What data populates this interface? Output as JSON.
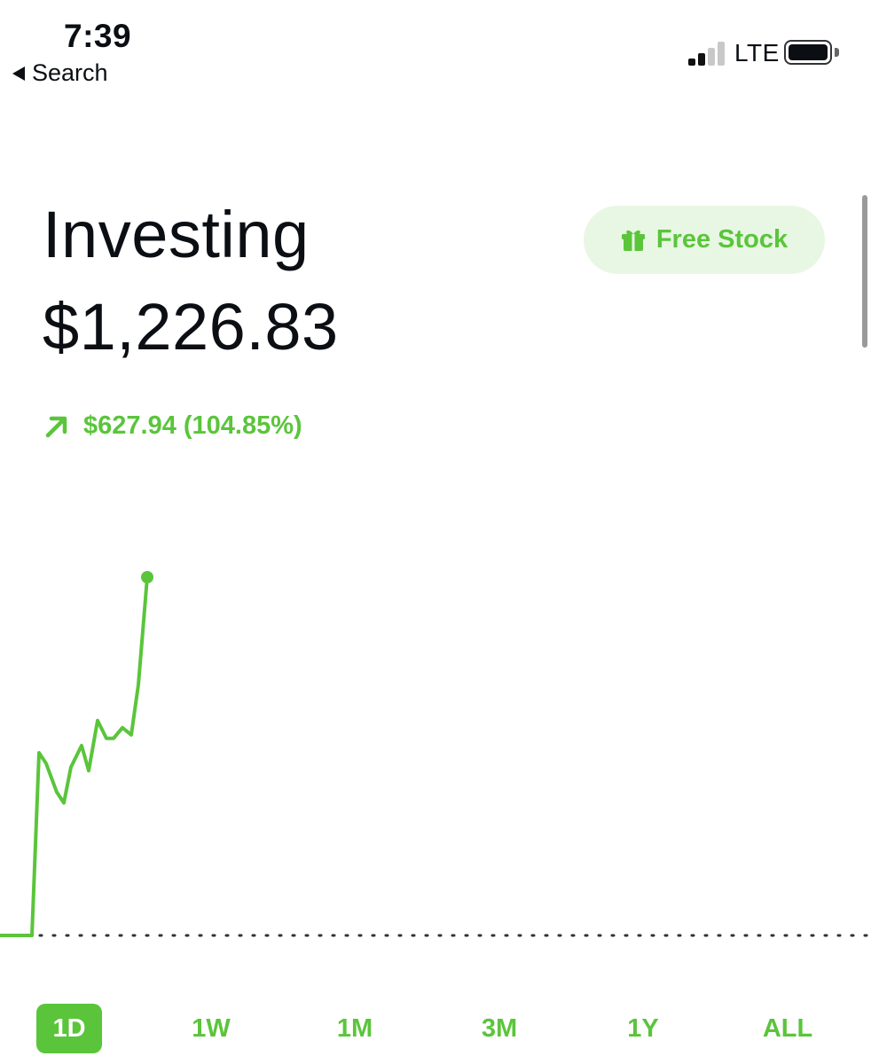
{
  "status_bar": {
    "time": "7:39",
    "back_label": "Search",
    "network": "LTE"
  },
  "header": {
    "title": "Investing",
    "balance": "$1,226.83",
    "change_text": "$627.94 (104.85%)",
    "free_stock_label": "Free Stock"
  },
  "colors": {
    "accent": "#5ac53b",
    "accent_light": "#e8f7e3",
    "text": "#0b0f14"
  },
  "icons": {
    "back": "back-arrow-icon",
    "gift": "gift-icon",
    "change": "arrow-up-right-icon"
  },
  "range_tabs": [
    {
      "label": "1D",
      "active": true
    },
    {
      "label": "1W",
      "active": false
    },
    {
      "label": "1M",
      "active": false
    },
    {
      "label": "3M",
      "active": false
    },
    {
      "label": "1Y",
      "active": false
    },
    {
      "label": "ALL",
      "active": false
    }
  ],
  "chart_data": {
    "type": "line",
    "series": [
      {
        "values": [
          0,
          0,
          0,
          0,
          0,
          0.51,
          0.48,
          0.4,
          0.37,
          0.47,
          0.53,
          0.46,
          0.6,
          0.55,
          0.55,
          0.58,
          0.56,
          0.7,
          1.0
        ]
      }
    ],
    "baseline": 0,
    "grid": false
  }
}
